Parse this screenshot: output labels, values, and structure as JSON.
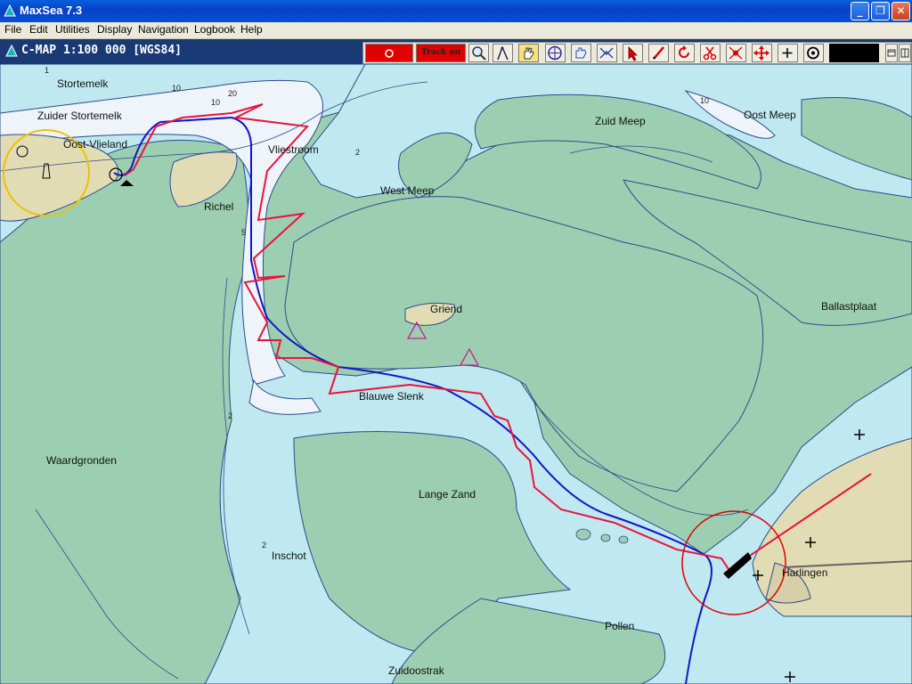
{
  "window": {
    "title": "MaxSea 7.3"
  },
  "menu": [
    "File",
    "Edit",
    "Utilities",
    "Display",
    "Navigation",
    "Logbook",
    "Help"
  ],
  "chart": {
    "title": "C-MAP  1:100 000 [WGS84]"
  },
  "toolbar": {
    "track_label": "Track on"
  },
  "places": {
    "stortemelk": "Stortemelk",
    "zuider_stortemelk": "Zuider Stortemelk",
    "oost_vlieland": "Oost-Vlieland",
    "richel": "Richel",
    "vliestroom": "Vliestroom",
    "west_meep": "West Meep",
    "zuid_meep": "Zuid Meep",
    "oost_meep": "Oost Meep",
    "griend": "Griend",
    "ballastplaat": "Ballastplaat",
    "blauwe_slenk": "Blauwe Slenk",
    "waardgronden": "Waardgronden",
    "lange_zand": "Lange Zand",
    "inschot": "Inschot",
    "harlingen": "Harlingen",
    "pollen": "Pollen",
    "zuidoostrak": "Zuidoostrak"
  },
  "depth_labels": {
    "d10a": "10",
    "d20": "20",
    "d10b": "10",
    "d2a": "2",
    "d5": "5",
    "d2b": "2",
    "d10c": "10",
    "d1": "1",
    "d2c": "2"
  },
  "colors": {
    "land": "#e2dcb5",
    "drying": "#9ccfb1",
    "shallow": "#bfe8f0",
    "deep": "#eef4fa",
    "track": "#1515c8",
    "route": "#e8143c"
  }
}
